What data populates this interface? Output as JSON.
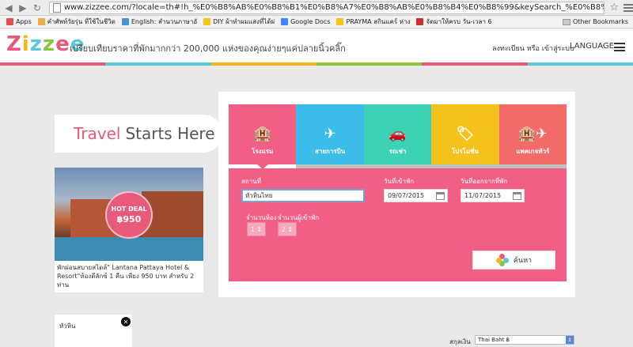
{
  "browser": {
    "url": "www.zizzee.com/?locale=th#!h_%E0%B8%AB%E0%B8%B1%E0%B8%A7%E0%B8%AB%E0%B8%B4%E0%B8%99&keySearch_%E0%B8%AB%E0%B8%B1...",
    "bookmarks": [
      {
        "label": "Apps",
        "color": "#d9534f"
      },
      {
        "label": "คำศัพท์วัยรุ่น ที่ใช้ในชีวิต",
        "color": "#f0ad4e"
      },
      {
        "label": "English: สำนวนภาษาอั",
        "color": "#4a90d9"
      },
      {
        "label": "DIY ผ้าทำผมแสงที่ได้ผ่",
        "color": "#f5c518"
      },
      {
        "label": "Google Docs",
        "color": "#4285f4"
      },
      {
        "label": "PRAYMA สกินแคร์ ห่าง",
        "color": "#f5c518"
      },
      {
        "label": "จัดมาให้ครบ วัน-เวลา 6",
        "color": "#c9302c"
      }
    ],
    "other_bookmarks": "Other Bookmarks"
  },
  "header": {
    "logo_letters": [
      "Z",
      "i",
      "z",
      "z",
      "e",
      "e"
    ],
    "logo_colors": [
      "#e85a7a",
      "#f2b61b",
      "#5cc8d7",
      "#8cc63f",
      "#e85a7a",
      "#5cc8d7"
    ],
    "tagline": "เปรียบเทียบราคาที่พักมากกว่า 200,000 แห่งของคุณง่ายๆแค่ปลายนิ้วคลิ๊ก",
    "auth": "ลงทะเบียน หรือ เข้าสู่ระบบ",
    "language": "LANGUAGE",
    "stripe_colors": [
      "#e85a7a",
      "#5cc8d7",
      "#f2b61b",
      "#8cc63f",
      "#e85a7a",
      "#5cc8d7"
    ]
  },
  "hero": {
    "title_accent": "Travel",
    "title_rest": "Starts Here"
  },
  "deal": {
    "badge_title": "HOT DEAL",
    "badge_price": "฿950",
    "description": "พักผ่อนสบายสไตล์\" Lantana Pattaya Hotel & Resort\"ห้องดีลักซ์ 1 คืน เพียง 950 บาท สำหรับ 2 ท่าน"
  },
  "tabs": [
    {
      "label": "โรงแรม",
      "icon": "🏨",
      "color": "#f25f86",
      "active": true
    },
    {
      "label": "สายการบิน",
      "icon": "✈",
      "color": "#3cbce8",
      "active": false
    },
    {
      "label": "รถเช่า",
      "icon": "🚗",
      "color": "#3dd1b6",
      "active": false
    },
    {
      "label": "โปรโมชั่น",
      "icon": "🏷",
      "color": "#f5c21b",
      "active": false
    },
    {
      "label": "แพคเกจทัวร์",
      "icon": "🏨✈",
      "color": "#f26a6a",
      "active": false
    }
  ],
  "form": {
    "location_label": "สถานที่",
    "location_value": "หัวหินไทย",
    "checkin_label": "วันที่เข้าพัก",
    "checkin_value": "09/07/2015",
    "checkout_label": "วันที่ออกจากที่พัก",
    "checkout_value": "11/07/2015",
    "rooms_label": "จำนวนห้อง",
    "rooms_value": "1",
    "guests_label": "จำนวนผู้เข้าพัก",
    "guests_value": "2",
    "search_label": "ค้นหา"
  },
  "footer": {
    "filter_label": "หัวหิน",
    "currency_label": "สกุลเงิน",
    "currency_value": "Thai Baht ฿"
  }
}
